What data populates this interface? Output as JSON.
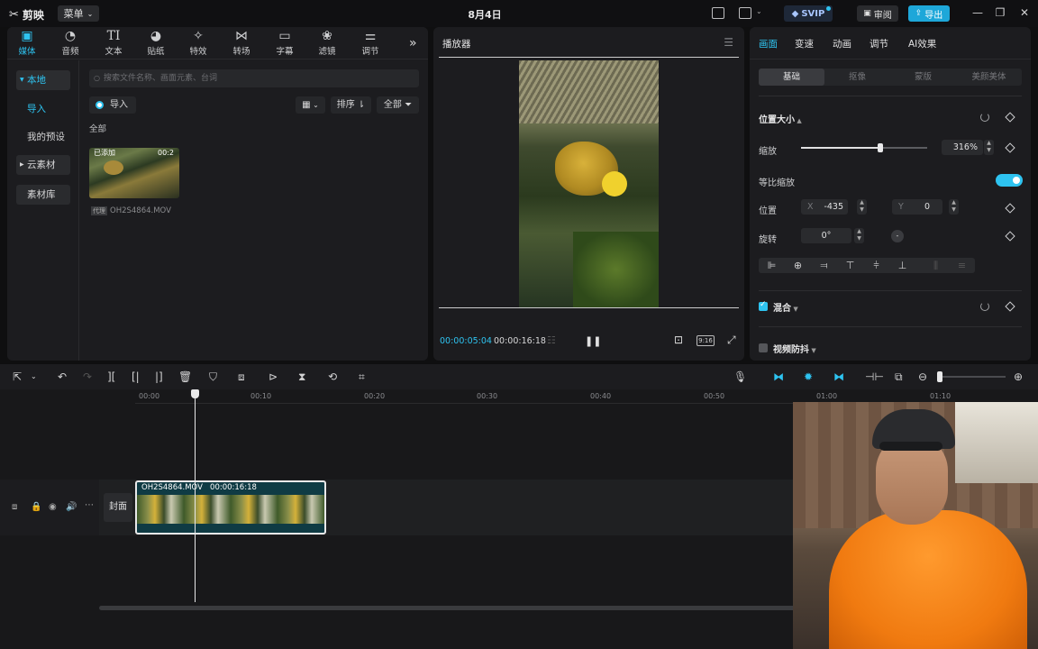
{
  "titlebar": {
    "app_name": "剪映",
    "menu_label": "菜单",
    "date": "8月4日",
    "svip_label": "SVIP",
    "review_label": "审阅",
    "export_label": "导出"
  },
  "toolbar": {
    "tabs": [
      {
        "label": "媒体",
        "icon": "media-icon"
      },
      {
        "label": "音频",
        "icon": "audio-icon"
      },
      {
        "label": "文本",
        "icon": "text-icon",
        "glyph": "TI"
      },
      {
        "label": "贴纸",
        "icon": "sticker-icon"
      },
      {
        "label": "特效",
        "icon": "effect-icon"
      },
      {
        "label": "转场",
        "icon": "transition-icon"
      },
      {
        "label": "字幕",
        "icon": "subtitle-icon"
      },
      {
        "label": "滤镜",
        "icon": "filter-icon"
      },
      {
        "label": "调节",
        "icon": "adjust-icon"
      }
    ]
  },
  "media": {
    "side": {
      "local": "本地",
      "import": "导入",
      "presets": "我的预设",
      "cloud": "云素材",
      "library": "素材库"
    },
    "search_placeholder": "搜索文件名称、画面元素、台词",
    "import_label": "导入",
    "sort_label": "排序",
    "filter_label": "全部",
    "all_label": "全部",
    "item": {
      "status": "已添加",
      "duration": "00:2",
      "tag": "代理",
      "filename": "OH2S4864.MOV"
    }
  },
  "player": {
    "title": "播放器",
    "current_time": "00:00:05:04",
    "total_time": "00:00:16:18",
    "ratio_label": "9:16"
  },
  "properties": {
    "tabs": [
      "画面",
      "变速",
      "动画",
      "调节",
      "AI效果"
    ],
    "subtabs": [
      "基础",
      "抠像",
      "蒙版",
      "美颜美体"
    ],
    "position_size_title": "位置大小",
    "scale_label": "缩放",
    "scale_value": "316%",
    "scale_fraction": 0.63,
    "uniform_scale_label": "等比缩放",
    "position_label": "位置",
    "x_label": "X",
    "x_value": "-435",
    "y_label": "Y",
    "y_value": "0",
    "rotation_label": "旋转",
    "rotation_value": "0°",
    "blend_label": "混合",
    "stabilize_label": "视频防抖"
  },
  "timeline": {
    "ruler_ticks": [
      "00:00",
      "00:10",
      "00:20",
      "00:30",
      "00:40",
      "00:50",
      "01:00",
      "01:10"
    ],
    "cover_label": "封面",
    "clip_name": "OH2S4864.MOV",
    "clip_duration": "00:00:16:18"
  },
  "colors": {
    "accent": "#2ec3f0",
    "export_bg": "#1ea7d9",
    "clip_bg": "#0f3b44"
  }
}
